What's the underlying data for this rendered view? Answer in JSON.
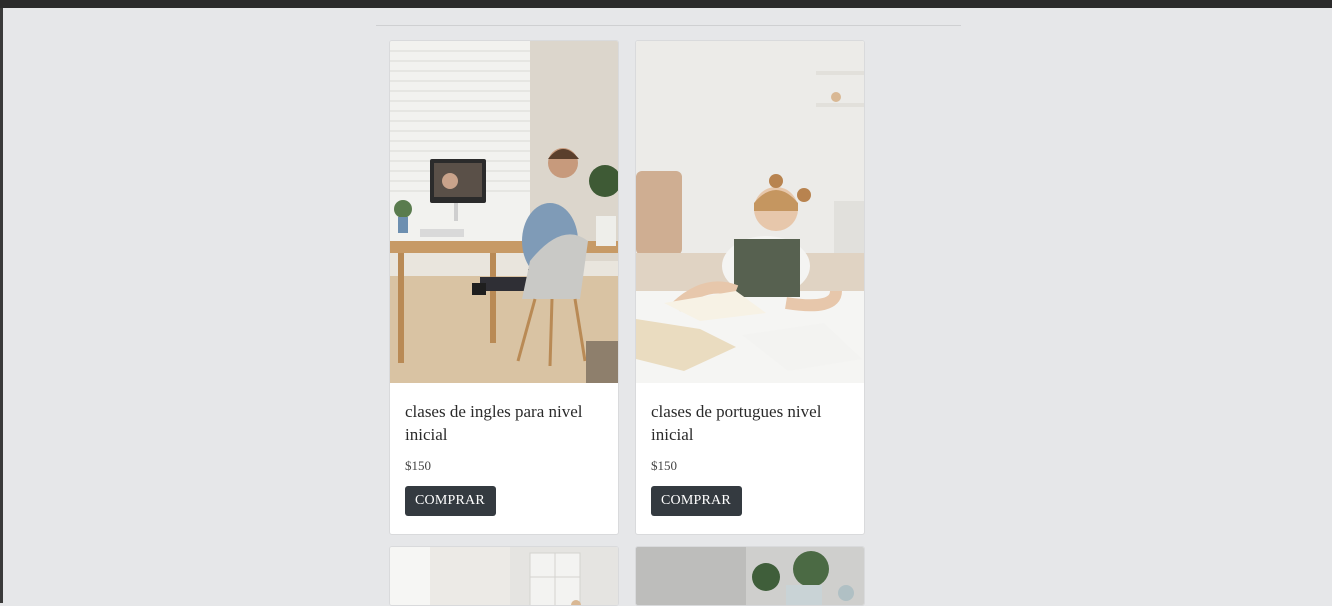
{
  "products": [
    {
      "title": "clases de ingles para nivel inicial",
      "price": "$150",
      "button": "COMPRAR"
    },
    {
      "title": "clases de portugues nivel inicial",
      "price": "$150",
      "button": "COMPRAR"
    }
  ]
}
